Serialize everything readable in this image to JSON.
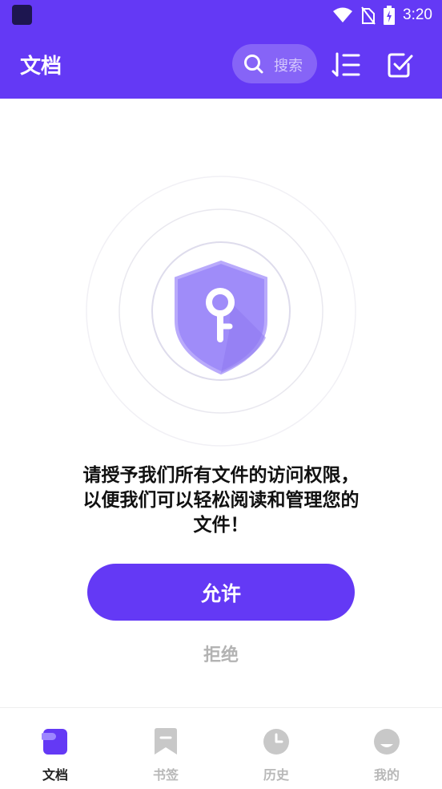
{
  "status_bar": {
    "time": "3:20"
  },
  "app_bar": {
    "title": "文档",
    "search_placeholder": "搜索"
  },
  "permission": {
    "message": "请授予我们所有文件的访问权限，\n以便我们可以轻松阅读和管理您的\n文件！",
    "allow_label": "允许",
    "deny_label": "拒绝"
  },
  "bottom_nav": {
    "items": [
      {
        "label": "文档",
        "icon": "document-icon",
        "active": true
      },
      {
        "label": "书签",
        "icon": "bookmark-icon",
        "active": false
      },
      {
        "label": "历史",
        "icon": "clock-icon",
        "active": false
      },
      {
        "label": "我的",
        "icon": "profile-icon",
        "active": false
      }
    ]
  },
  "colors": {
    "brand": "#6439f5",
    "shield": "#9f8cf9",
    "inactive": "#c8c8c8"
  }
}
